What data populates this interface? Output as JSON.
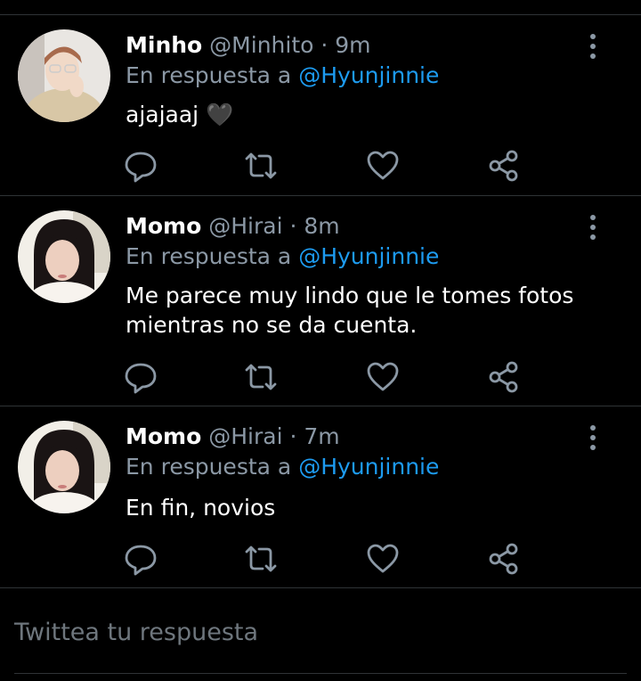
{
  "replies": [
    {
      "name": "Minho",
      "handle": "@Minhito",
      "separator": "·",
      "time": "9m",
      "reply_prefix": "En respuesta a",
      "reply_to": "@Hyunjinnie",
      "text": "ajajaaj 🖤",
      "avatar": "avatar-minho"
    },
    {
      "name": "Momo",
      "handle": "@Hirai",
      "separator": "·",
      "time": "8m",
      "reply_prefix": "En respuesta a",
      "reply_to": "@Hyunjinnie",
      "text_lines": [
        "Me parece muy lindo que le tomes fotos",
        "mientras no se da cuenta."
      ],
      "avatar": "avatar-momo"
    },
    {
      "name": "Momo",
      "handle": "@Hirai",
      "separator": "·",
      "time": "7m",
      "reply_prefix": "En respuesta a",
      "reply_to": "@Hyunjinnie",
      "text": "En fin, novios",
      "avatar": "avatar-momo"
    }
  ],
  "actions": [
    "reply-icon",
    "retweet-icon",
    "like-icon",
    "share-icon"
  ],
  "compose": {
    "placeholder": "Twittea tu respuesta"
  },
  "colors": {
    "background": "#000000",
    "secondary_text": "#8b98a5",
    "mention": "#1d9bf0",
    "divider": "#2f3336"
  }
}
